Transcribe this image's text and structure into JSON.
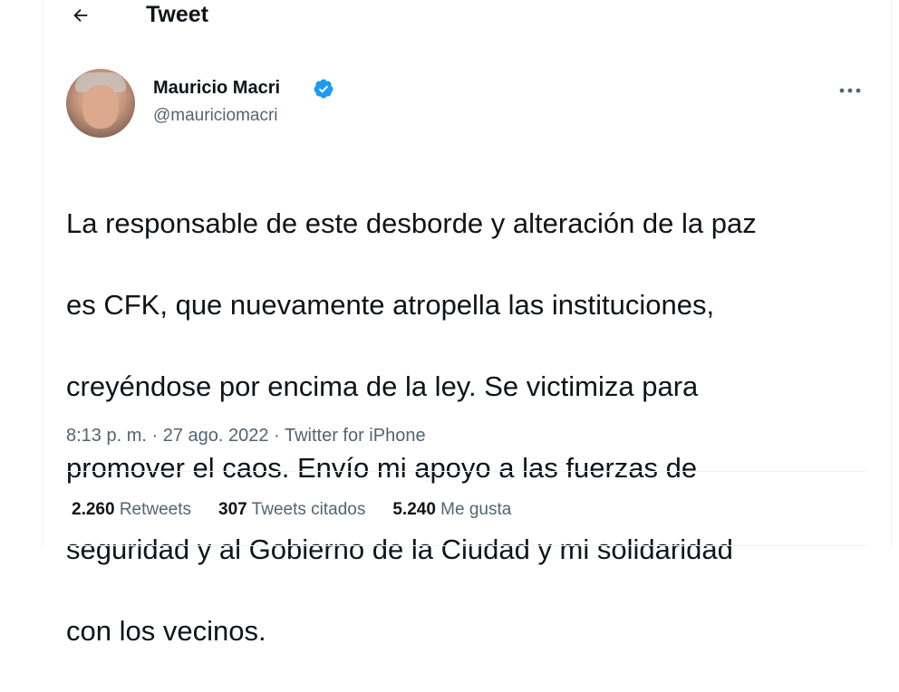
{
  "header": {
    "title": "Tweet",
    "back_icon": "arrow-left-icon"
  },
  "author": {
    "name": "Mauricio Macri",
    "handle": "@mauriciomacri",
    "verified_color": "#1d9bf0"
  },
  "tweet": {
    "text_lines": [
      "La responsable de este desborde y alteración de la paz",
      "es CFK, que nuevamente atropella las instituciones,",
      "creyéndose por encima de la ley. Se victimiza para",
      "promover el caos. Envío mi apoyo a las fuerzas de",
      "seguridad y al Gobierno de la Ciudad y mi solidaridad",
      "con los vecinos."
    ],
    "time": "8:13 p. m.",
    "date": "27 ago. 2022",
    "source": "Twitter for iPhone",
    "separator": "·"
  },
  "stats": {
    "retweets": {
      "count": "2.260",
      "label": "Retweets"
    },
    "quotes": {
      "count": "307",
      "label": "Tweets citados"
    },
    "likes": {
      "count": "5.240",
      "label": "Me gusta"
    }
  },
  "colors": {
    "text": "#0f1419",
    "secondary": "#536471",
    "accent": "#1d9bf0",
    "border": "#eff3f4"
  }
}
